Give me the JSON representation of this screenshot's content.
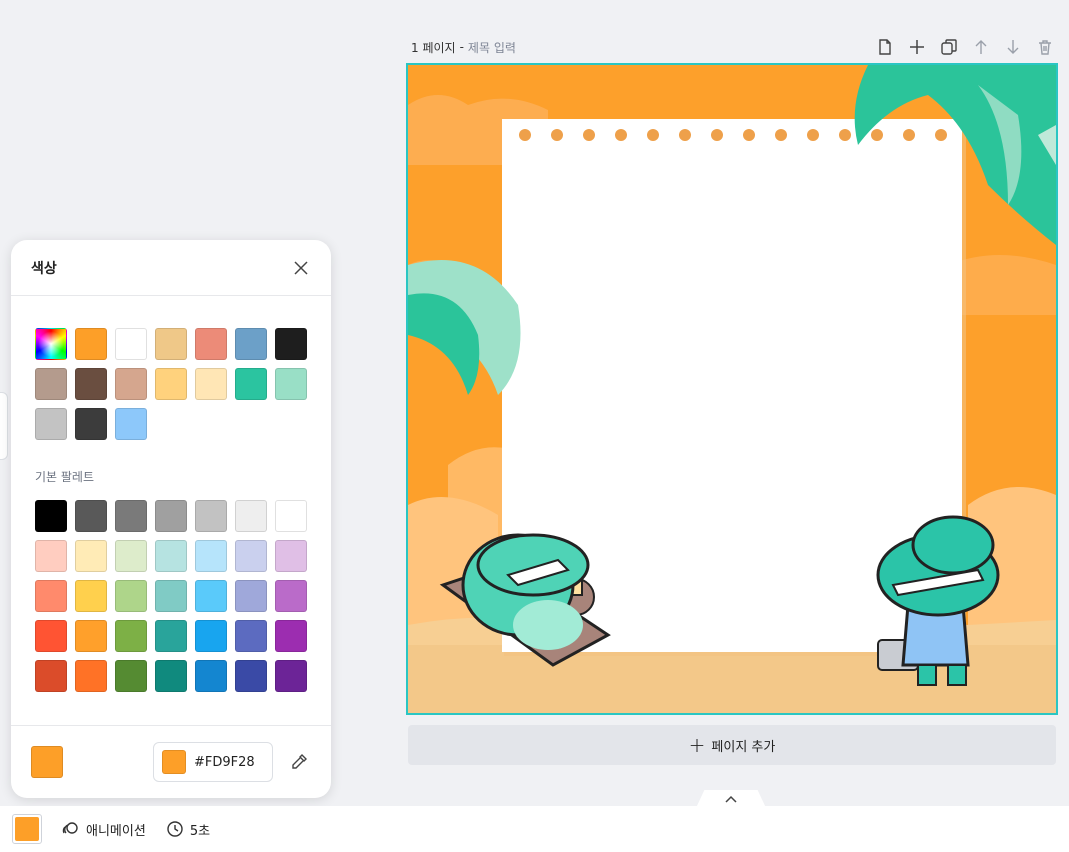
{
  "page_header": {
    "page_label": "1 페이지",
    "separator": "-",
    "title_placeholder": "제목 입력"
  },
  "toolbar_icons": [
    "page-icon",
    "plus-icon",
    "copy-icon",
    "arrow-up-icon",
    "arrow-down-icon",
    "trash-icon"
  ],
  "add_page": {
    "label": "페이지 추가"
  },
  "color_panel": {
    "title": "색상",
    "document_colors": [
      "rainbow",
      "#FD9F28",
      "#FFFFFF",
      "#EFC888",
      "#EC8B78",
      "#6CA0C8",
      "#1E1E1E",
      "#B49B8D",
      "#6A4E40",
      "#D5A68E",
      "#FFD27D",
      "#FFE6B5",
      "#2BC4A0",
      "#99DFC6",
      "#C3C3C3",
      "#3C3C3C",
      "#8DC8FA"
    ],
    "palette_label": "기본 팔레트",
    "basic_palette": [
      "#000000",
      "#595959",
      "#7A7A7A",
      "#A0A0A0",
      "#C2C2C2",
      "#EEEEEE",
      "#FFFFFF",
      "#FFCDC0",
      "#FFEBB6",
      "#DDECCB",
      "#B6E3E1",
      "#B6E4FB",
      "#CAD0EE",
      "#E0BFE6",
      "#FF8A6C",
      "#FFD04D",
      "#AED58A",
      "#80CBC5",
      "#5ACAFA",
      "#9FA8DA",
      "#BA6BC9",
      "#FF5433",
      "#FFA02B",
      "#7DB046",
      "#29A49B",
      "#18A5EF",
      "#5C6BC0",
      "#9C2DB0",
      "#DB4C2A",
      "#FF7226",
      "#558B32",
      "#108A7E",
      "#1486D0",
      "#3A4AA6",
      "#6C2497"
    ],
    "current_color": "#FD9F28",
    "hex_value": "#FD9F28"
  },
  "bottom_bar": {
    "background_color": "#FD9F28",
    "animation_label": "애니메이션",
    "duration_label": "5초"
  },
  "colors": {
    "canvas_border": "#2AC6C3",
    "accent_orange": "#FD9F28"
  }
}
